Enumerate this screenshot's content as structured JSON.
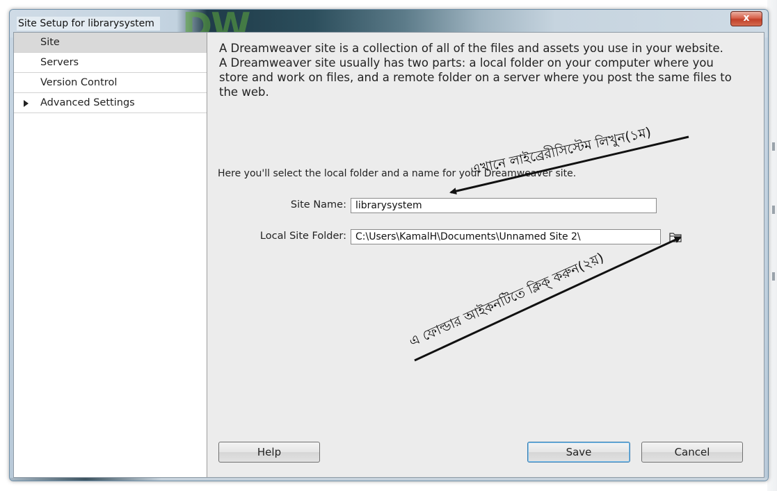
{
  "window": {
    "title": "Site Setup for librarysystem",
    "watermark": "DW",
    "close_symbol": "x"
  },
  "sidebar": {
    "items": [
      {
        "label": "Site",
        "selected": true
      },
      {
        "label": "Servers"
      },
      {
        "label": "Version Control"
      },
      {
        "label": "Advanced Settings",
        "expandable": true
      }
    ]
  },
  "main": {
    "intro": "A Dreamweaver site is a collection of all of the files and assets you use in your website. A Dreamweaver site usually has two parts: a local folder on your computer where you store and work on files, and a remote folder on a server where you post the same files to the web.",
    "instruction": "Here you'll select the local folder and a name for your Dreamweaver site.",
    "site_name_label": "Site Name:",
    "site_name_value": "librarysystem",
    "local_folder_label": "Local Site Folder:",
    "local_folder_value": "C:\\Users\\KamalH\\Documents\\Unnamed Site 2\\",
    "browse_icon": "folder-icon"
  },
  "buttons": {
    "help": "Help",
    "save": "Save",
    "cancel": "Cancel"
  },
  "annotations": {
    "step1": "এখানে লাইব্রেরীসিস্টেম লিখুন(১ম)",
    "step2": "এ ফোল্ডার আইকনটিতে ক্লিক্ করুন(২য়)"
  },
  "colors": {
    "accent": "#3c7fb1",
    "close": "#c1412a",
    "arrow": "#111111"
  }
}
